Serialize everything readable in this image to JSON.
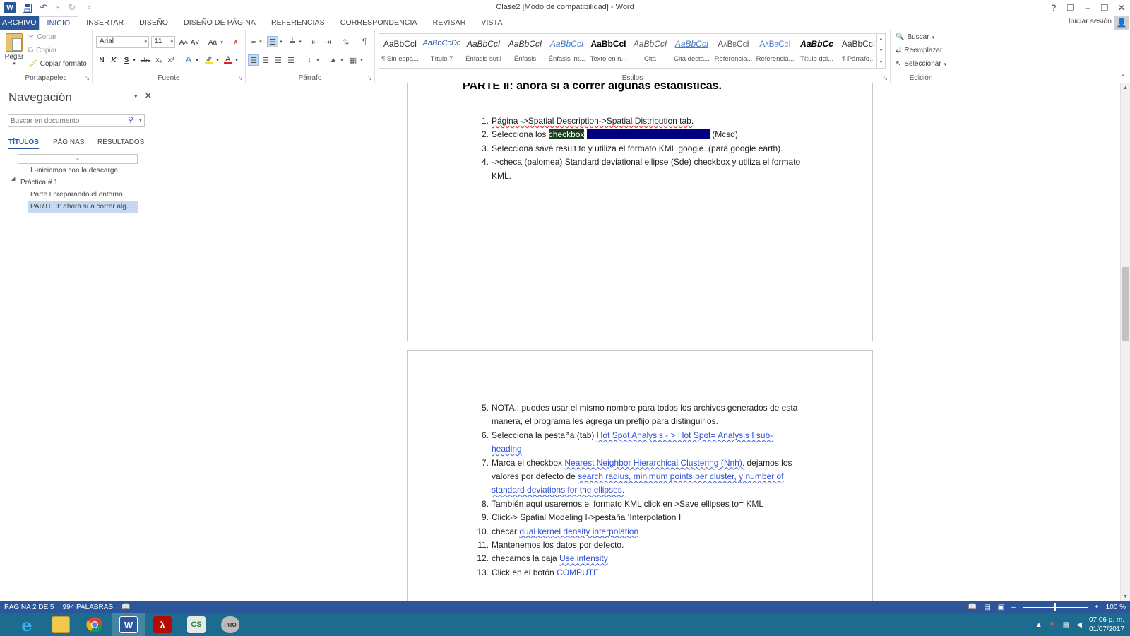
{
  "window": {
    "title": "Clase2 [Modo de compatibilidad] - Word",
    "help": "?",
    "ribbon_display": "❐",
    "minimize": "–",
    "restore": "❒",
    "close": "✕"
  },
  "qat": {
    "save_icon": "save-icon",
    "undo_icon": "undo-icon",
    "redo_icon": "redo-icon",
    "customize": "≡"
  },
  "tabs": [
    "ARCHIVO",
    "INICIO",
    "INSERTAR",
    "DISEÑO",
    "DISEÑO DE PÁGINA",
    "REFERENCIAS",
    "CORRESPONDENCIA",
    "REVISAR",
    "VISTA"
  ],
  "active_tab": "INICIO",
  "signin": "Iniciar sesión",
  "clipboard": {
    "paste": "Pegar",
    "cut": "Cortar",
    "copy": "Copiar",
    "format_painter": "Copiar formato",
    "label": "Portapapeles"
  },
  "font": {
    "name": "Arial",
    "size": "11",
    "grow": "A˄",
    "shrink": "A˅",
    "case": "Aa",
    "bold": "N",
    "italic": "K",
    "underline": "S",
    "strike": "abc",
    "subscript": "x₂",
    "superscript": "x²",
    "label": "Fuente"
  },
  "paragraph": {
    "label": "Párrafo",
    "pilcrow": "¶"
  },
  "styles": {
    "label": "Estilos",
    "items": [
      {
        "sample": "AaBbCcI",
        "name": "¶ Sin espa...",
        "style": "normal"
      },
      {
        "sample": "AaBbCcDc",
        "name": "Título 7",
        "style": "t7"
      },
      {
        "sample": "AaBbCcI",
        "name": "Énfasis sutil",
        "style": "italic"
      },
      {
        "sample": "AaBbCcI",
        "name": "Énfasis",
        "style": "italic"
      },
      {
        "sample": "AaBbCcI",
        "name": "Énfasis int...",
        "style": "intense"
      },
      {
        "sample": "AaBbCcI",
        "name": "Texto en n...",
        "style": "bold"
      },
      {
        "sample": "AaBbCcI",
        "name": "Cita",
        "style": "quote"
      },
      {
        "sample": "AaBbCcI",
        "name": "Cita desta...",
        "style": "iquote"
      },
      {
        "sample": "AaBbCcI",
        "name": "Referencia...",
        "style": "ref"
      },
      {
        "sample": "AaBbCcI",
        "name": "Referencia...",
        "style": "iref"
      },
      {
        "sample": "AaBbCc",
        "name": "Título del...",
        "style": "booktitle"
      },
      {
        "sample": "AaBbCcI",
        "name": "¶ Párrafo...",
        "style": "normal"
      }
    ]
  },
  "editing": {
    "find": "Buscar",
    "replace": "Reemplazar",
    "select": "Seleccionar",
    "label": "Edición"
  },
  "nav": {
    "title": "Navegación",
    "search_placeholder": "Buscar en documento",
    "tabs": [
      "TÍTULOS",
      "PÁGINAS",
      "RESULTADOS"
    ],
    "collapse_all": "˄",
    "items": [
      {
        "label": "I.-iniciemos con la descarga",
        "level": 2
      },
      {
        "label": "Práctica # 1.",
        "level": 1
      },
      {
        "label": "Parte I preparando el entorno",
        "level": 2
      },
      {
        "label": "PARTE II:  ahora sí a correr algun...",
        "level": 2,
        "selected": true
      }
    ]
  },
  "document": {
    "heading": "PARTE II:  ahora sí a correr algunas estadísticas.",
    "page1_items": [
      {
        "num": "1.",
        "text": "Página ->Spatial Description->Spatial Distribution tab."
      },
      {
        "num": "2.",
        "text_a": "Selecciona los ",
        "hl1": "checkbox",
        "hl2": "mean center y standard distance",
        "text_b": " (Mcsd)."
      },
      {
        "num": "3.",
        "text": "Selecciona save result to y utiliza el formato KML google. (para google earth)."
      },
      {
        "num": "4.",
        "text": "->checa (palomea) Standard deviational ellipse (Sde) checkbox y utiliza el formato KML."
      }
    ],
    "page2_items": [
      {
        "num": "5.",
        "text": "NOTA.: puedes usar el mismo nombre para todos los archivos generados de esta manera, el programa les agrega un prefijo para distinguirlos."
      },
      {
        "num": "6.",
        "text_a": "Selecciona la pestaña (tab) ",
        "blue": "Hot Spot Analysis - > Hot Spot= Analysis I sub-heading"
      },
      {
        "num": "7.",
        "text_a": "Marca el checkbox ",
        "blue": "Nearest Neighbor Hierarchical Clustering (Nnh).",
        "text_b": " dejamos los valores por defecto de ",
        "blue2": "search radius, minimum points per cluster, y number of standard deviations for the ellipses."
      },
      {
        "num": "8.",
        "text": "También aquí usaremos el formato KML  click en >Save ellipses to= KML"
      },
      {
        "num": "9.",
        "text": "Click-> Spatial Modeling I->pestaña  ‘Interpolation I’"
      },
      {
        "num": "10.",
        "text_a": "checar ",
        "blue": "dual kernel density interpolation"
      },
      {
        "num": "11.",
        "text": "Mantenemos los datos por defecto."
      },
      {
        "num": "12.",
        "text_a": "checamos la caja  ",
        "blue": "Use intensity"
      },
      {
        "num": "13.",
        "text_a": "Click en el botón ",
        "blue": "COMPUTE."
      }
    ]
  },
  "status": {
    "page": "PÁGINA 2 DE 5",
    "words": "994 PALABRAS",
    "zoom": "100 %"
  },
  "taskbar": {
    "apps": [
      "internet-explorer-icon",
      "file-explorer-icon",
      "chrome-icon",
      "word-icon",
      "acrobat-icon",
      "crimestat-icon",
      "pro-app-icon"
    ],
    "time": "07:06 p. m.",
    "date": "01/07/2017"
  },
  "colors": {
    "accent": "#2b579a",
    "taskbar": "#1d6b8e",
    "link_blue": "#3050d8"
  }
}
